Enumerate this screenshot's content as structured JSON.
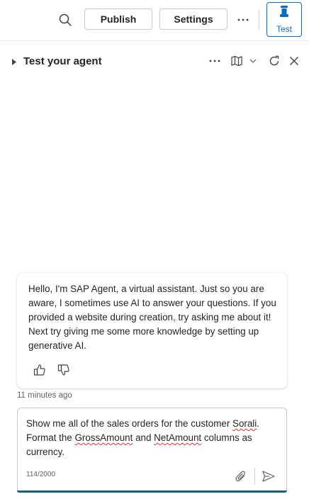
{
  "toolbar": {
    "search_icon": "search-icon",
    "publish_label": "Publish",
    "settings_label": "Settings",
    "more_icon": "more-horizontal-icon",
    "test_label": "Test",
    "accent": "#0f6cbd"
  },
  "panel": {
    "title": "Test your agent",
    "expand_icon": "caret-right-icon",
    "more_icon": "more-horizontal-icon",
    "map_icon": "map-icon",
    "dropdown_icon": "chevron-down-icon",
    "refresh_icon": "refresh-icon",
    "close_icon": "close-icon"
  },
  "conversation": {
    "bot_message": "Hello, I'm SAP Agent, a virtual assistant. Just so you are aware, I sometimes use AI to answer your questions. If you provided a website during creation, try asking me about it! Next try giving me some more knowledge by setting up generative AI.",
    "timestamp": "11 minutes ago",
    "thumbs_up_icon": "thumbs-up-icon",
    "thumbs_down_icon": "thumbs-down-icon"
  },
  "composer": {
    "text_part1": "Show me all of the sales orders for the customer ",
    "text_sorali": "Sorali",
    "text_part2": ". Format the ",
    "text_gross": "GrossAmount",
    "text_part3": " and ",
    "text_net": "NetAmount",
    "text_part4": " columns as currency.",
    "char_count": "114/2000",
    "attach_icon": "paperclip-icon",
    "send_icon": "send-icon",
    "accent": "#17607e"
  }
}
